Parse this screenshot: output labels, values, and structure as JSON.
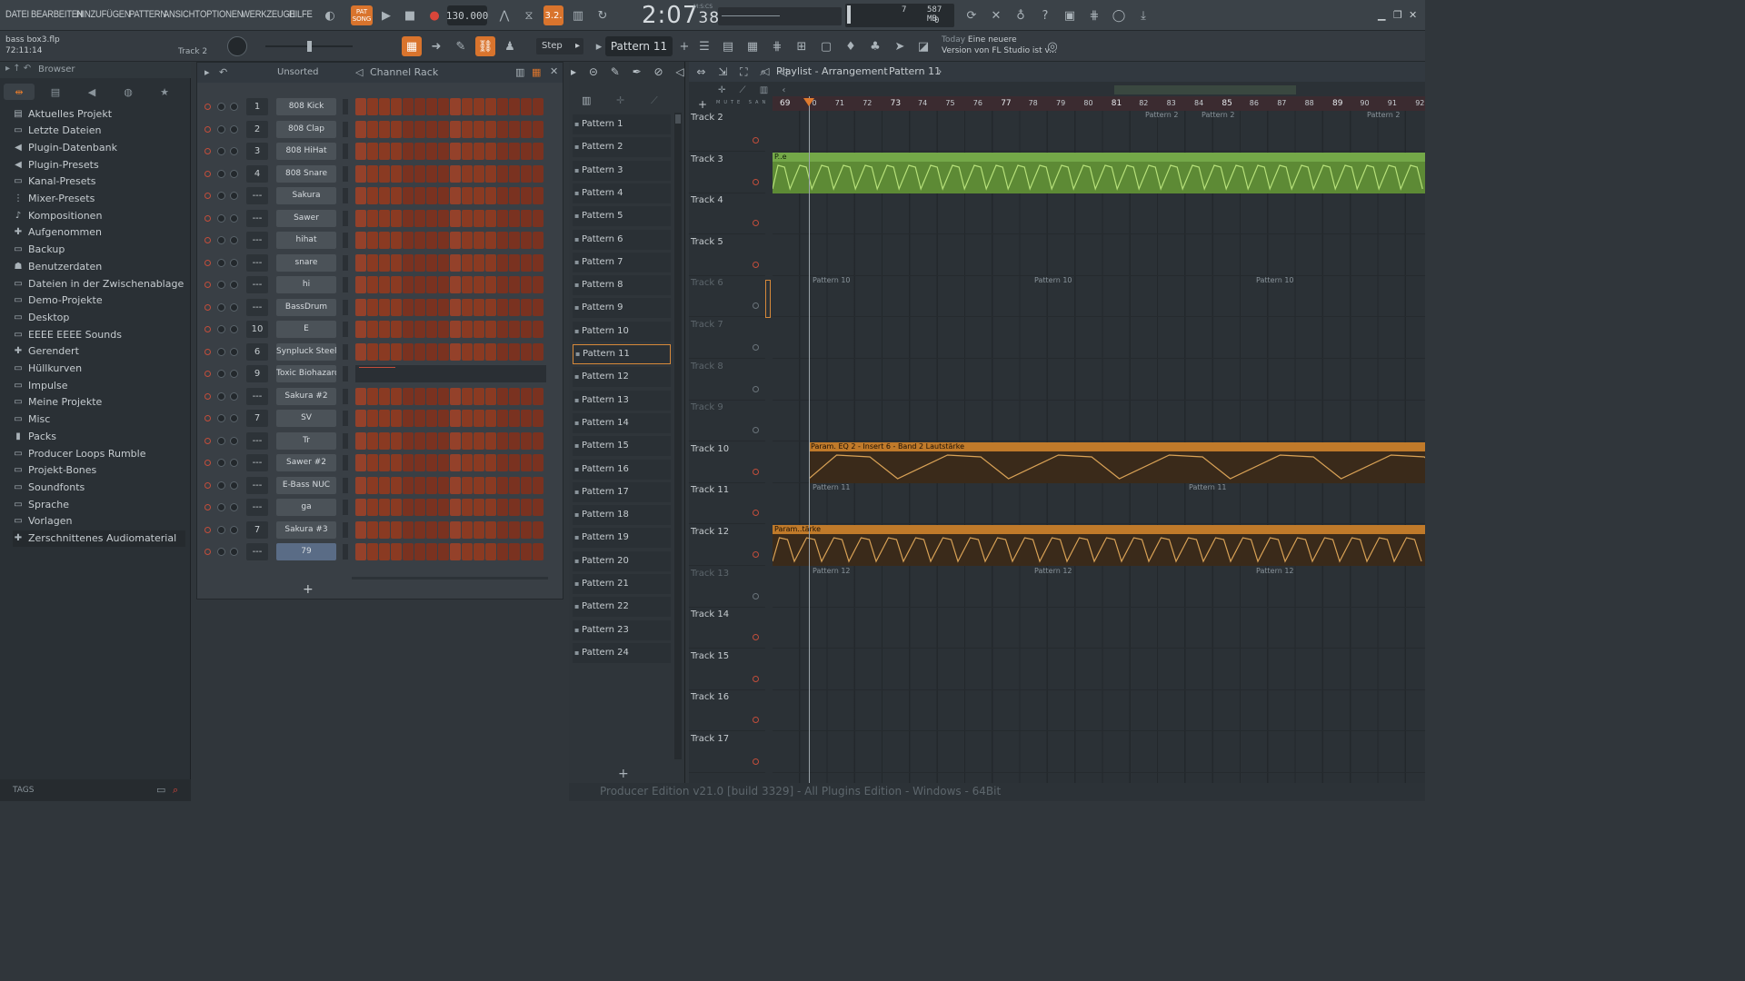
{
  "menu": [
    "DATEI",
    "BEARBEITEN",
    "HINZUFÜGEN",
    "PATTERN",
    "ANSICHT",
    "OPTIONEN",
    "WERKZEUGE",
    "HILFE"
  ],
  "transport": {
    "pat_label": "PAT",
    "song_label": "SONG",
    "tempo": "130.000",
    "time_main": "2:07",
    "time_small": "38",
    "time_unit": "M:S:CS",
    "snap_badge": "3.2."
  },
  "cpu": {
    "voices": "7",
    "ram": "587 MB",
    "zero": "0"
  },
  "file": {
    "name": "bass box3.flp",
    "timecode": "72:11:14",
    "track_hint": "Track 2"
  },
  "toolbar2": {
    "step": "Step",
    "pattern": "Pattern 11"
  },
  "news": {
    "day": "Today",
    "headline": "Eine neuere",
    "body": "Version von FL Studio ist v..."
  },
  "browser": {
    "title": "Browser",
    "items": [
      {
        "label": "Aktuelles Projekt",
        "icon": "▤"
      },
      {
        "label": "Letzte Dateien",
        "icon": "▭"
      },
      {
        "label": "Plugin-Datenbank",
        "icon": "◀"
      },
      {
        "label": "Plugin-Presets",
        "icon": "◀"
      },
      {
        "label": "Kanal-Presets",
        "icon": "▭"
      },
      {
        "label": "Mixer-Presets",
        "icon": "⋮"
      },
      {
        "label": "Kompositionen",
        "icon": "♪"
      },
      {
        "label": "Aufgenommen",
        "icon": "✚"
      },
      {
        "label": "Backup",
        "icon": "▭"
      },
      {
        "label": "Benutzerdaten",
        "icon": "☗"
      },
      {
        "label": "Dateien in der Zwischenablage",
        "icon": "▭"
      },
      {
        "label": "Demo-Projekte",
        "icon": "▭"
      },
      {
        "label": "Desktop",
        "icon": "▭"
      },
      {
        "label": "EEEE EEEE Sounds",
        "icon": "▭"
      },
      {
        "label": "Gerendert",
        "icon": "✚"
      },
      {
        "label": "Hüllkurven",
        "icon": "▭"
      },
      {
        "label": "Impulse",
        "icon": "▭"
      },
      {
        "label": "Meine Projekte",
        "icon": "▭"
      },
      {
        "label": "Misc",
        "icon": "▭"
      },
      {
        "label": "Packs",
        "icon": "▮"
      },
      {
        "label": "Producer Loops Rumble",
        "icon": "▭"
      },
      {
        "label": "Projekt-Bones",
        "icon": "▭"
      },
      {
        "label": "Soundfonts",
        "icon": "▭"
      },
      {
        "label": "Sprache",
        "icon": "▭"
      },
      {
        "label": "Vorlagen",
        "icon": "▭"
      },
      {
        "label": "Zerschnittenes Audiomaterial",
        "icon": "✚"
      }
    ],
    "tags": "TAGS"
  },
  "rack": {
    "title": "Channel Rack",
    "sort": "Unsorted",
    "channels": [
      {
        "num": "1",
        "name": "808 Kick"
      },
      {
        "num": "2",
        "name": "808 Clap"
      },
      {
        "num": "3",
        "name": "808 HiHat"
      },
      {
        "num": "4",
        "name": "808 Snare"
      },
      {
        "num": "---",
        "name": "Sakura"
      },
      {
        "num": "---",
        "name": "Sawer"
      },
      {
        "num": "---",
        "name": "hihat"
      },
      {
        "num": "---",
        "name": "snare"
      },
      {
        "num": "---",
        "name": "hi"
      },
      {
        "num": "---",
        "name": "BassDrum"
      },
      {
        "num": "10",
        "name": "E"
      },
      {
        "num": "6",
        "name": "Synpluck Steel"
      },
      {
        "num": "9",
        "name": "Toxic Biohazard"
      },
      {
        "num": "---",
        "name": "Sakura #2"
      },
      {
        "num": "7",
        "name": "SV"
      },
      {
        "num": "---",
        "name": "Tr"
      },
      {
        "num": "---",
        "name": "Sawer #2"
      },
      {
        "num": "---",
        "name": "E-Bass NUC"
      },
      {
        "num": "---",
        "name": "ga"
      },
      {
        "num": "7",
        "name": "Sakura #3"
      },
      {
        "num": "---",
        "name": "79"
      }
    ]
  },
  "patterns": [
    "Pattern 1",
    "Pattern 2",
    "Pattern 3",
    "Pattern 4",
    "Pattern 5",
    "Pattern 6",
    "Pattern 7",
    "Pattern 8",
    "Pattern 9",
    "Pattern 10",
    "Pattern 11",
    "Pattern 12",
    "Pattern 13",
    "Pattern 14",
    "Pattern 15",
    "Pattern 16",
    "Pattern 17",
    "Pattern 18",
    "Pattern 19",
    "Pattern 20",
    "Pattern 21",
    "Pattern 22",
    "Pattern 23",
    "Pattern 24"
  ],
  "selected_pattern": "Pattern 11",
  "playlist": {
    "title": "Playlist - Arrangement",
    "pattern": "Pattern 11",
    "ruler": [
      "69",
      "70",
      "71",
      "72",
      "73",
      "74",
      "75",
      "76",
      "77",
      "78",
      "79",
      "80",
      "81",
      "82",
      "83",
      "84",
      "85",
      "86",
      "87",
      "88",
      "89",
      "90",
      "91",
      "92"
    ],
    "tracks": [
      "Track 2",
      "Track 3",
      "Track 4",
      "Track 5",
      "Track 6",
      "Track 7",
      "Track 8",
      "Track 9",
      "Track 10",
      "Track 11",
      "Track 12",
      "Track 13",
      "Track 14",
      "Track 15",
      "Track 16",
      "Track 17"
    ],
    "automation_label": "Param. EQ 2 - Insert 6 - Band 2 Lautstärke",
    "automation_short": "Param..tärke",
    "green_label": "P..e",
    "clip_p2": "Pattern 2",
    "clip_p10": "Pattern 10",
    "clip_p11": "Pattern 11",
    "clip_p12": "Pattern 12"
  },
  "footer": "Producer Edition v21.0 [build 3329] - All Plugins Edition - Windows - 64Bit"
}
